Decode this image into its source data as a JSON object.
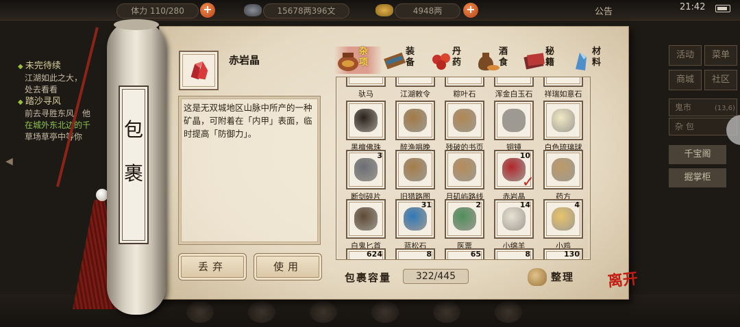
{
  "topbar": {
    "stat1": "体力 110/280",
    "money": "15678两396文",
    "gold": "4948两",
    "announce": "公告",
    "clock": "21:42"
  },
  "quests": [
    {
      "title": "未完待续",
      "lines": [
        "江湖如此之大，",
        "处去看看"
      ]
    },
    {
      "title": "踏沙寻风",
      "lines": [
        "前去寻胜东风，他",
        "在城外东北边的千",
        "草场草亭中等你"
      ]
    }
  ],
  "right_panel": {
    "buttons": [
      "活动",
      "菜单",
      "商城",
      "社区"
    ],
    "location": "鬼市",
    "coords": "(13,6)",
    "sub": "杂 包",
    "shops": [
      "千宝阁",
      "掘掌柜"
    ]
  },
  "scroll": {
    "chars": [
      "包",
      "裹"
    ]
  },
  "detail": {
    "name": "赤岩晶",
    "description": "这是无双城地区山脉中所产的一种矿晶，可附着在「内甲」表面，临时提高「防御力」。",
    "discard_label": "丢弃",
    "use_label": "使用"
  },
  "tabs": [
    {
      "label": "杂项",
      "icon": "jar-icon",
      "active": true
    },
    {
      "label": "装备",
      "icon": "equipment-icon",
      "active": false
    },
    {
      "label": "丹药",
      "icon": "pill-icon",
      "active": false
    },
    {
      "label": "酒食",
      "icon": "food-icon",
      "active": false
    },
    {
      "label": "秘籍",
      "icon": "book-icon",
      "active": false
    },
    {
      "label": "材料",
      "icon": "crystal-icon",
      "active": false
    }
  ],
  "partial_top_names": [
    "驮马",
    "江湖敕令",
    "粽叶石",
    "浑金白玉石",
    "祥瑞如意石"
  ],
  "items": [
    {
      "name": "黑檀佛珠",
      "count": "",
      "icon": "prayer-beads-icon",
      "color": "#2a211a"
    },
    {
      "name": "醉渔唱晚",
      "count": "",
      "icon": "book-icon",
      "color": "#a27a45"
    },
    {
      "name": "残破的书页",
      "count": "",
      "icon": "torn-page-icon",
      "color": "#b08752"
    },
    {
      "name": "铜镜",
      "count": "",
      "icon": "mirror-icon",
      "color": "#9c9a93"
    },
    {
      "name": "白色琉璃球",
      "count": "",
      "icon": "orb-icon",
      "color": "#f1e8c4"
    },
    {
      "name": "断剑碎片",
      "count": "3",
      "icon": "sword-shard-icon",
      "color": "#6a6d73"
    },
    {
      "name": "旧猎路图",
      "count": "",
      "icon": "map-icon",
      "color": "#a57d49"
    },
    {
      "name": "月矶屿路线",
      "count": "",
      "icon": "route-map-icon",
      "color": "#b58c58"
    },
    {
      "name": "赤岩晶",
      "count": "10",
      "icon": "red-crystal-icon",
      "color": "#b3262b",
      "selected": true
    },
    {
      "name": "药方",
      "count": "",
      "icon": "prescription-icon",
      "color": "#bd9a66"
    },
    {
      "name": "白鬼匕首",
      "count": "",
      "icon": "dagger-icon",
      "color": "#5e4a35"
    },
    {
      "name": "蓝松石",
      "count": "31",
      "icon": "turquoise-icon",
      "color": "#2f79b8"
    },
    {
      "name": "医票",
      "count": "2",
      "icon": "ticket-icon",
      "color": "#4f8f5a"
    },
    {
      "name": "小绵羊",
      "count": "14",
      "icon": "sheep-icon",
      "color": "#e8e2d4"
    },
    {
      "name": "小鸡",
      "count": "4",
      "icon": "chick-icon",
      "color": "#e8c36a"
    }
  ],
  "partial_bottom_counts": [
    "624",
    "8",
    "65",
    "8",
    "130"
  ],
  "capacity": {
    "label": "包裹容量",
    "value": "322/445"
  },
  "sort_label": "整理",
  "leave_label": "离开"
}
